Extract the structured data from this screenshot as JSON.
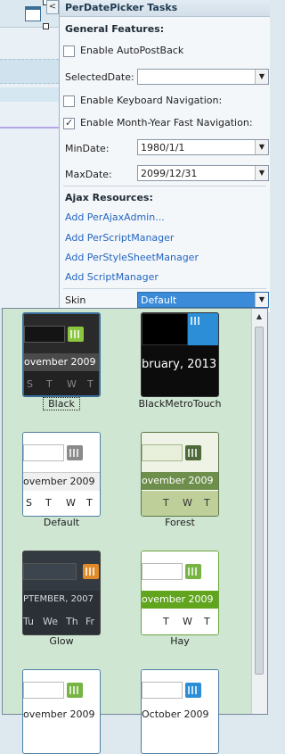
{
  "panel": {
    "title": "PerDatePicker Tasks",
    "general_title": "General Features:",
    "enable_autopostback": "Enable AutoPostBack",
    "selected_date_label": "SelectedDate:",
    "selected_date_value": "",
    "enable_keyboard_nav": "Enable Keyboard Navigation:",
    "enable_month_year_nav": "Enable Month-Year Fast Navigation:",
    "min_date_label": "MinDate:",
    "min_date_value": "1980/1/1",
    "max_date_label": "MaxDate:",
    "max_date_value": "2099/12/31",
    "ajax_title": "Ajax Resources:",
    "links": [
      "Add PerAjaxAdmin...",
      "Add PerScriptManager",
      "Add PerStyleSheetManager",
      "Add ScriptManager"
    ],
    "skin_label": "Skin",
    "skin_value": "Default"
  },
  "collapse_glyph": "<",
  "skins": [
    {
      "name": "Black",
      "month": "ovember 2009",
      "days": [
        "S",
        "T",
        "W",
        "T"
      ]
    },
    {
      "name": "BlackMetroTouch",
      "month": "bruary, 2013",
      "days": []
    },
    {
      "name": "Default",
      "month": "ovember 2009",
      "days": [
        "S",
        "T",
        "W",
        "T"
      ]
    },
    {
      "name": "Forest",
      "month": "ovember 2009",
      "days": [
        "T",
        "W",
        "T"
      ]
    },
    {
      "name": "Glow",
      "month": "PTEMBER, 2007",
      "days": [
        "Tu",
        "We",
        "Th",
        "Fr"
      ]
    },
    {
      "name": "Hay",
      "month": "ovember 2009",
      "days": [
        "T",
        "W",
        "T"
      ]
    },
    {
      "name": "",
      "month": "ovember 2009",
      "days": []
    },
    {
      "name": "",
      "month": "October 2009",
      "days": []
    }
  ],
  "colors": {
    "accent": "#3b8bd9",
    "link": "#2566c2",
    "dropdown_bg": "#cfe6d3"
  }
}
